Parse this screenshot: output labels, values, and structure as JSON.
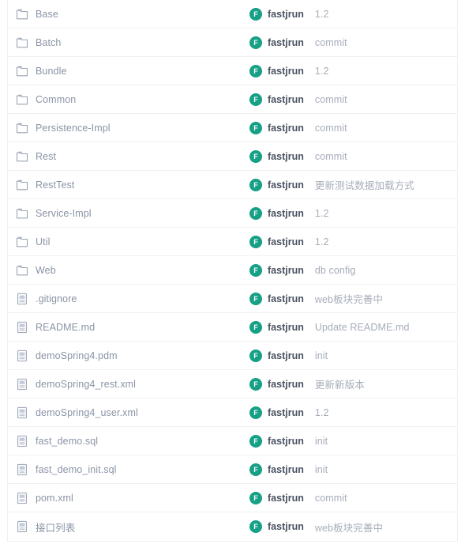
{
  "file_browser": {
    "icons": {
      "folder": "folder-icon",
      "file": "file-icon",
      "avatar": "user-avatar"
    },
    "colors": {
      "avatar_background": "#16a085",
      "avatar_text": "#ffffff",
      "row_border": "#eef0f2",
      "name_text": "#8a94a6",
      "author_text": "#4a5261",
      "commit_text": "#a6adba"
    },
    "avatar_initial": "F",
    "rows": [
      {
        "type": "folder",
        "name": "Base",
        "author": "fastjrun",
        "commit": "1.2"
      },
      {
        "type": "folder",
        "name": "Batch",
        "author": "fastjrun",
        "commit": "commit"
      },
      {
        "type": "folder",
        "name": "Bundle",
        "author": "fastjrun",
        "commit": "1.2"
      },
      {
        "type": "folder",
        "name": "Common",
        "author": "fastjrun",
        "commit": "commit"
      },
      {
        "type": "folder",
        "name": "Persistence-Impl",
        "author": "fastjrun",
        "commit": "commit"
      },
      {
        "type": "folder",
        "name": "Rest",
        "author": "fastjrun",
        "commit": "commit"
      },
      {
        "type": "folder",
        "name": "RestTest",
        "author": "fastjrun",
        "commit": "更新测试数据加载方式"
      },
      {
        "type": "folder",
        "name": "Service-Impl",
        "author": "fastjrun",
        "commit": "1.2"
      },
      {
        "type": "folder",
        "name": "Util",
        "author": "fastjrun",
        "commit": "1.2"
      },
      {
        "type": "folder",
        "name": "Web",
        "author": "fastjrun",
        "commit": "db config"
      },
      {
        "type": "file",
        "name": ".gitignore",
        "author": "fastjrun",
        "commit": "web板块完善中"
      },
      {
        "type": "file",
        "name": "README.md",
        "author": "fastjrun",
        "commit": "Update README.md"
      },
      {
        "type": "file",
        "name": "demoSpring4.pdm",
        "author": "fastjrun",
        "commit": "init"
      },
      {
        "type": "file",
        "name": "demoSpring4_rest.xml",
        "author": "fastjrun",
        "commit": "更新新版本"
      },
      {
        "type": "file",
        "name": "demoSpring4_user.xml",
        "author": "fastjrun",
        "commit": "1.2"
      },
      {
        "type": "file",
        "name": "fast_demo.sql",
        "author": "fastjrun",
        "commit": "init"
      },
      {
        "type": "file",
        "name": "fast_demo_init.sql",
        "author": "fastjrun",
        "commit": "init"
      },
      {
        "type": "file",
        "name": "pom.xml",
        "author": "fastjrun",
        "commit": "commit"
      },
      {
        "type": "file",
        "name": "接口列表",
        "author": "fastjrun",
        "commit": "web板块完善中"
      }
    ]
  }
}
